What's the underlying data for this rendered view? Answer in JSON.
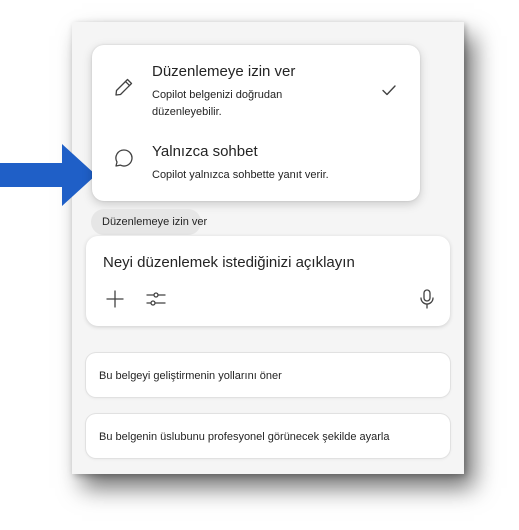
{
  "mode_menu": {
    "edit_option": {
      "title": "Düzenlemeye izin ver",
      "description": "Copilot belgenizi doğrudan düzenleyebilir.",
      "icon": "pencil-icon",
      "selected": true
    },
    "chat_option": {
      "title": "Yalnızca sohbet",
      "description": "Copilot yalnızca sohbette yanıt verir.",
      "icon": "chat-bubble-icon",
      "selected": false
    }
  },
  "mode_chip": {
    "label": "Düzenlemeye izin ver"
  },
  "composer": {
    "placeholder": "Neyi düzenlemek istediğinizi açıklayın",
    "icons": [
      "plus-icon",
      "sliders-icon",
      "microphone-icon"
    ]
  },
  "suggestions": [
    {
      "label": "Bu belgeyi geliştirmenin yollarını öner"
    },
    {
      "label": "Bu belgenin üslubunu profesyonel görünecek şekilde ayarla"
    }
  ],
  "colors": {
    "arrow": "#1f5fc7",
    "panel": "#f5f5f5",
    "text": "#242424"
  }
}
